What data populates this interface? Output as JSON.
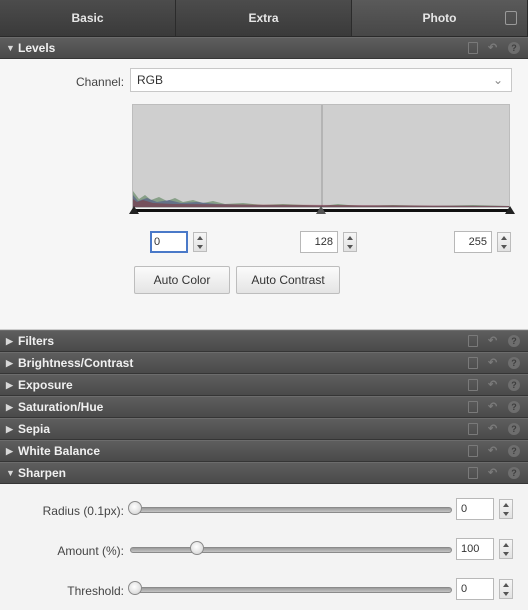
{
  "tabs": [
    {
      "label": "Basic"
    },
    {
      "label": "Extra"
    },
    {
      "label": "Photo",
      "active": true
    }
  ],
  "levels": {
    "title": "Levels",
    "expanded": true,
    "channel_label": "Channel:",
    "channel_value": "RGB",
    "input_black": "0",
    "input_gamma": "128",
    "input_white": "255",
    "auto_color_label": "Auto Color",
    "auto_contrast_label": "Auto Contrast"
  },
  "sections": [
    {
      "title": "Filters"
    },
    {
      "title": "Brightness/Contrast"
    },
    {
      "title": "Exposure"
    },
    {
      "title": "Saturation/Hue"
    },
    {
      "title": "Sepia"
    },
    {
      "title": "White Balance"
    }
  ],
  "sharpen": {
    "title": "Sharpen",
    "expanded": true,
    "radius_label": "Radius (0.1px):",
    "radius_value": "0",
    "amount_label": "Amount (%):",
    "amount_value": "100",
    "threshold_label": "Threshold:",
    "threshold_value": "0"
  },
  "icons": {
    "collapsed_arrow": "▶",
    "expanded_arrow": "▼",
    "undo": "↶",
    "help": "?"
  },
  "colors": {
    "header_bg": "#4f4f4f",
    "panel_bg": "#f3f3f3",
    "focus_border": "#4a79c8"
  }
}
